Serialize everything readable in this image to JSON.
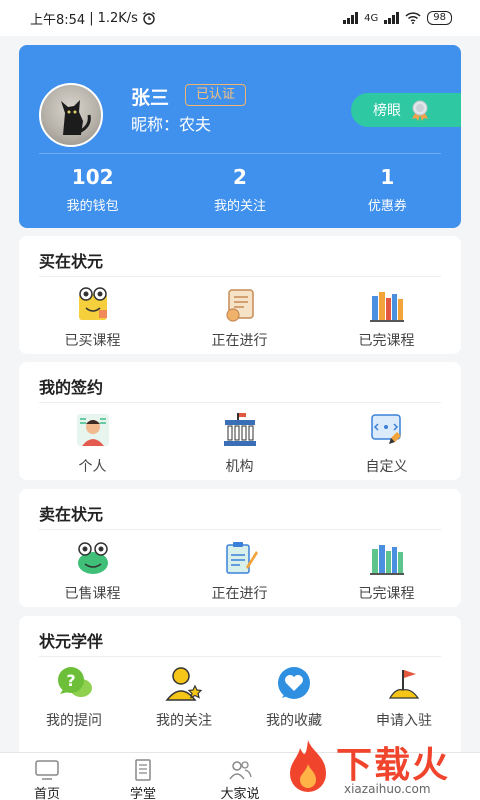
{
  "status_bar": {
    "time": "上午8:54",
    "speed": "1.2K/s",
    "battery": "98",
    "network": "4G"
  },
  "profile": {
    "name": "张三",
    "verified": "已认证",
    "nickname_label": "昵称：",
    "nickname": "农夫",
    "rank_button": "榜眼",
    "stats": [
      {
        "value": "102",
        "label": "我的钱包"
      },
      {
        "value": "2",
        "label": "我的关注"
      },
      {
        "value": "1",
        "label": "优惠券"
      }
    ]
  },
  "sections": {
    "buy": {
      "title": "买在状元",
      "items": [
        {
          "label": "已买课程",
          "icon": "frog-book-icon"
        },
        {
          "label": "正在进行",
          "icon": "scroll-icon"
        },
        {
          "label": "已完课程",
          "icon": "books-icon"
        }
      ]
    },
    "contract": {
      "title": "我的签约",
      "items": [
        {
          "label": "个人",
          "icon": "person-icon"
        },
        {
          "label": "机构",
          "icon": "institution-icon"
        },
        {
          "label": "自定义",
          "icon": "custom-icon"
        }
      ]
    },
    "sell": {
      "title": "卖在状元",
      "items": [
        {
          "label": "已售课程",
          "icon": "frog-icon"
        },
        {
          "label": "正在进行",
          "icon": "clipboard-pencil-icon"
        },
        {
          "label": "已完课程",
          "icon": "books-green-icon"
        }
      ]
    },
    "partner": {
      "title": "状元学伴",
      "items": [
        {
          "label": "我的提问",
          "icon": "question-bubble-icon"
        },
        {
          "label": "我的关注",
          "icon": "user-star-icon"
        },
        {
          "label": "我的收藏",
          "icon": "heart-bubble-icon"
        },
        {
          "label": "申请入驻",
          "icon": "flag-icon"
        }
      ]
    }
  },
  "bottom_nav": [
    {
      "label": "首页",
      "icon": "tv-icon"
    },
    {
      "label": "学堂",
      "icon": "document-icon"
    },
    {
      "label": "大家说",
      "icon": "people-icon"
    }
  ],
  "watermark": {
    "text": "下载火",
    "url": "xiazaihuo.com"
  },
  "colors": {
    "primary_blue": "#4090ee",
    "rank_green": "#2ec9a3",
    "badge_orange": "#f2b56a",
    "watermark_red": "#f0442c"
  }
}
